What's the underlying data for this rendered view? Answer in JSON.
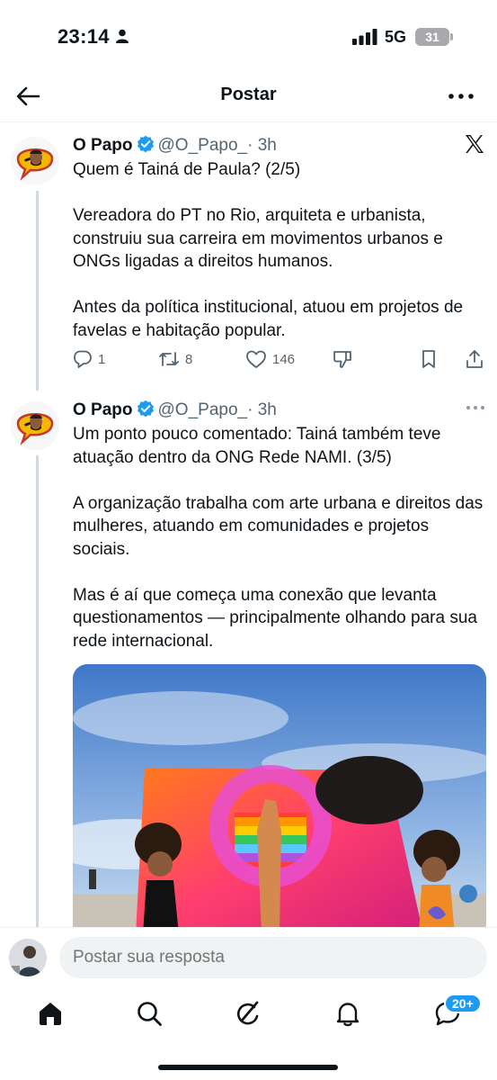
{
  "status_bar": {
    "time": "23:14",
    "network": "5G",
    "battery": "31"
  },
  "header": {
    "title": "Postar"
  },
  "tweets": [
    {
      "name": "O Papo",
      "handle": "@O_Papo_",
      "time": "· 3h",
      "paragraphs": [
        "Quem é Tainá de Paula? (2/5)",
        "Vereadora do PT no Rio, arquiteta e urbanista, construiu sua carreira em movimentos urbanos e ONGs ligadas a direitos humanos.",
        "Antes da política institucional, atuou em projetos de favelas e habitação popular."
      ],
      "replies": "1",
      "reposts": "8",
      "likes": "146"
    },
    {
      "name": "O Papo",
      "handle": "@O_Papo_",
      "time": "· 3h",
      "paragraphs": [
        "Um ponto pouco comentado: Tainá também teve atuação dentro da ONG Rede NAMI. (3/5)",
        "A organização trabalha com arte urbana e direitos das mulheres, atuando em comunidades e projetos sociais.",
        "Mas é aí que começa uma conexão que levanta questionamentos — principalmente olhando para sua rede internacional."
      ]
    }
  ],
  "reply": {
    "placeholder": "Postar sua resposta"
  },
  "tabbar": {
    "messages_badge": "20+"
  },
  "colors": {
    "accent": "#1d9bf0",
    "text": "#0f1419",
    "secondary": "#536471",
    "thread_line": "#cfd9de"
  },
  "icons": [
    "person-icon",
    "signal-icon",
    "back-arrow-icon",
    "more-icon",
    "verified-icon",
    "x-logo-icon",
    "reply-icon",
    "repost-icon",
    "like-icon",
    "downvote-icon",
    "bookmark-icon",
    "share-icon",
    "home-icon",
    "search-icon",
    "grok-icon",
    "notifications-icon",
    "messages-icon"
  ]
}
